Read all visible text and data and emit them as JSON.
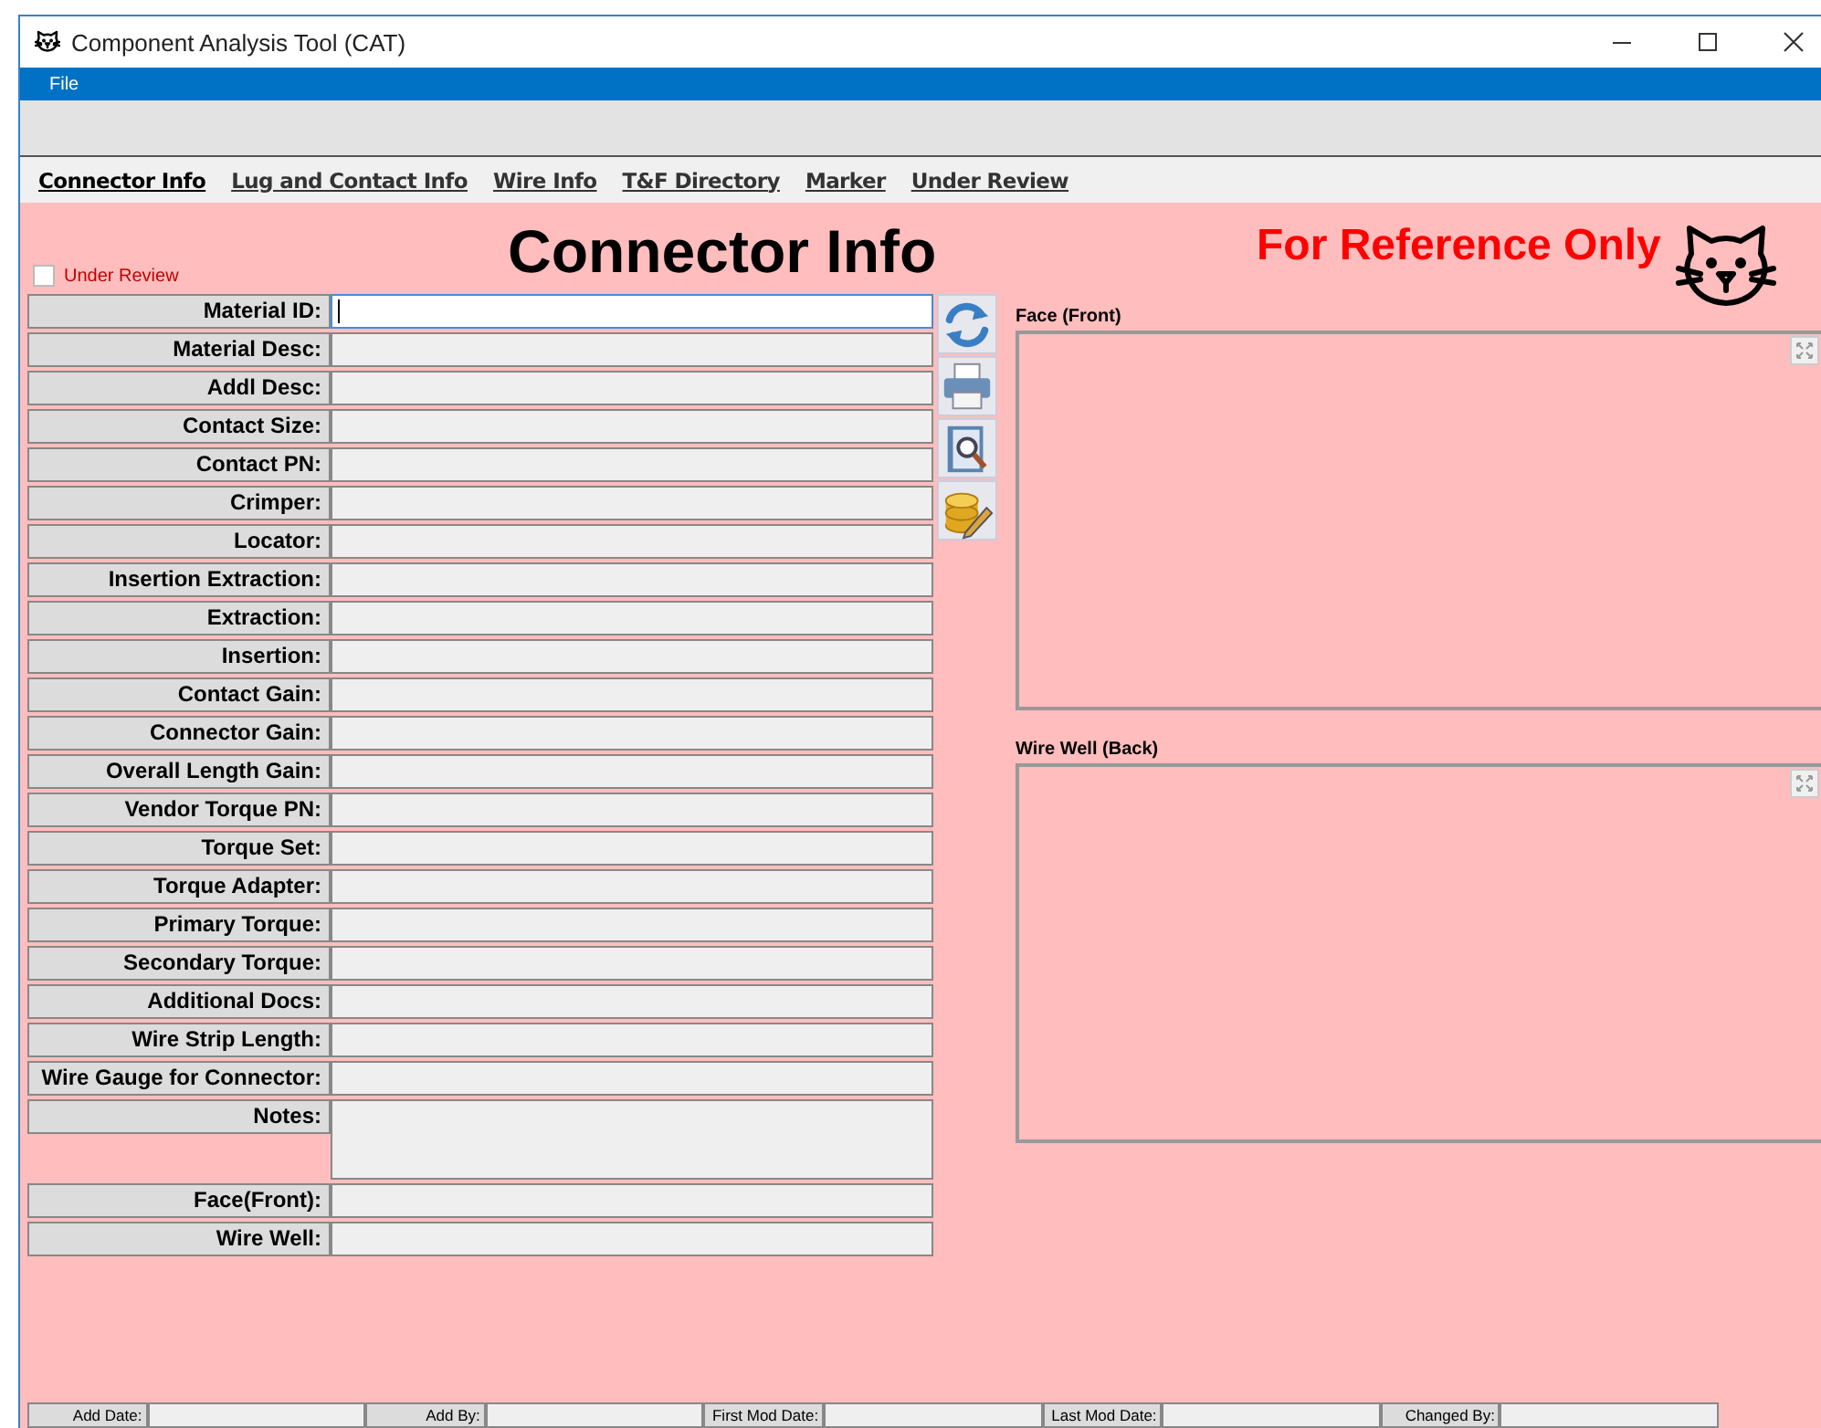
{
  "window": {
    "title": "Component Analysis Tool (CAT)"
  },
  "menu": [
    "File"
  ],
  "tabs": [
    {
      "label": "Connector Info",
      "selected": true
    },
    {
      "label": "Lug and Contact Info",
      "selected": false
    },
    {
      "label": "Wire Info",
      "selected": false
    },
    {
      "label": "T&F Directory",
      "selected": false
    },
    {
      "label": "Marker",
      "selected": false
    },
    {
      "label": "Under Review",
      "selected": false
    }
  ],
  "under_review": {
    "label": "Under Review",
    "checked": false
  },
  "heading": "Connector Info",
  "reference_note": "For Reference Only",
  "fields": [
    {
      "label": "Material ID:",
      "kind": "line",
      "focused": true
    },
    {
      "label": "Material Desc:",
      "kind": "line",
      "focused": false
    },
    {
      "label": "Addl Desc:",
      "kind": "line",
      "focused": false
    },
    {
      "label": "Contact Size:",
      "kind": "line",
      "focused": false
    },
    {
      "label": "Contact PN:",
      "kind": "line",
      "focused": false
    },
    {
      "label": "Crimper:",
      "kind": "line",
      "focused": false
    },
    {
      "label": "Locator:",
      "kind": "line",
      "focused": false
    },
    {
      "label": "Insertion Extraction:",
      "kind": "line",
      "focused": false
    },
    {
      "label": "Extraction:",
      "kind": "line",
      "focused": false
    },
    {
      "label": "Insertion:",
      "kind": "line",
      "focused": false
    },
    {
      "label": "Contact Gain:",
      "kind": "line",
      "focused": false
    },
    {
      "label": "Connector Gain:",
      "kind": "line",
      "focused": false
    },
    {
      "label": "Overall Length Gain:",
      "kind": "line",
      "focused": false
    },
    {
      "label": "Vendor Torque PN:",
      "kind": "line",
      "focused": false
    },
    {
      "label": "Torque Set:",
      "kind": "line",
      "focused": false
    },
    {
      "label": "Torque Adapter:",
      "kind": "line",
      "focused": false
    },
    {
      "label": "Primary Torque:",
      "kind": "line",
      "focused": false
    },
    {
      "label": "Secondary Torque:",
      "kind": "line",
      "focused": false
    },
    {
      "label": "Additional Docs:",
      "kind": "line",
      "focused": false
    },
    {
      "label": "Wire Strip Length:",
      "kind": "line",
      "focused": false
    },
    {
      "label": "Wire Gauge for Connector:",
      "kind": "line",
      "focused": false
    },
    {
      "label": "Notes:",
      "kind": "multiline",
      "focused": false
    },
    {
      "label": "Face(Front):",
      "kind": "line",
      "focused": false
    },
    {
      "label": "Wire Well:",
      "kind": "line",
      "focused": false
    }
  ],
  "actions": [
    {
      "kind": "refresh"
    },
    {
      "kind": "print"
    },
    {
      "kind": "preview"
    },
    {
      "kind": "database"
    }
  ],
  "image_panels": [
    {
      "title": "Face (Front)"
    },
    {
      "title": "Wire Well (Back)"
    }
  ],
  "footer": [
    {
      "label": "Add Date:"
    },
    {
      "label": "Add By:"
    },
    {
      "label": "First Mod Date:"
    },
    {
      "label": "Last Mod Date:"
    },
    {
      "label": "Changed By:"
    }
  ]
}
